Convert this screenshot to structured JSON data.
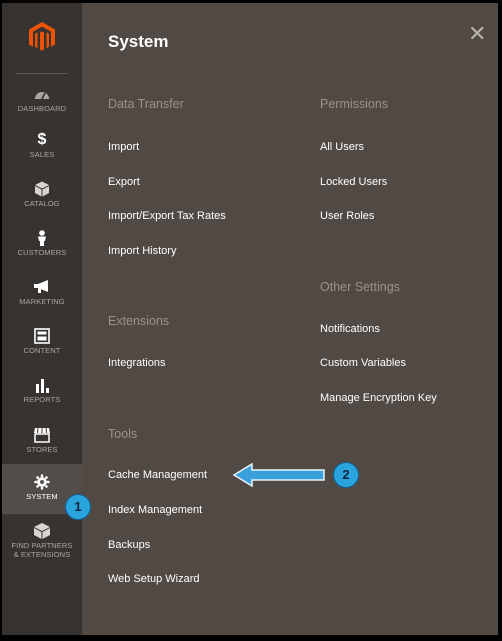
{
  "sidebar": {
    "items": [
      {
        "label": "DASHBOARD",
        "icon": "dashboard-gauge-icon"
      },
      {
        "label": "SALES",
        "icon": "dollar-icon"
      },
      {
        "label": "CATALOG",
        "icon": "cube-icon"
      },
      {
        "label": "CUSTOMERS",
        "icon": "person-icon"
      },
      {
        "label": "MARKETING",
        "icon": "megaphone-icon"
      },
      {
        "label": "CONTENT",
        "icon": "layout-icon"
      },
      {
        "label": "REPORTS",
        "icon": "bar-chart-icon"
      },
      {
        "label": "STORES",
        "icon": "store-icon"
      },
      {
        "label": "SYSTEM",
        "icon": "gear-icon"
      },
      {
        "label1": "FIND PARTNERS",
        "label2": "& EXTENSIONS",
        "icon": "extension-box-icon"
      }
    ]
  },
  "panel": {
    "title": "System",
    "close_icon": "close-icon",
    "sections": {
      "data_transfer": {
        "heading": "Data Transfer",
        "links": [
          "Import",
          "Export",
          "Import/Export Tax Rates",
          "Import History"
        ]
      },
      "extensions": {
        "heading": "Extensions",
        "links": [
          "Integrations"
        ]
      },
      "tools": {
        "heading": "Tools",
        "links": [
          "Cache Management",
          "Index Management",
          "Backups",
          "Web Setup Wizard"
        ]
      },
      "permissions": {
        "heading": "Permissions",
        "links": [
          "All Users",
          "Locked Users",
          "User Roles"
        ]
      },
      "other_settings": {
        "heading": "Other Settings",
        "links": [
          "Notifications",
          "Custom Variables",
          "Manage Encryption Key"
        ]
      }
    }
  },
  "annotations": {
    "badge1": "1",
    "badge2": "2",
    "arrow_color": "#3aa0dc"
  },
  "colors": {
    "sidebar_bg": "#373330",
    "panel_bg": "#514943",
    "logo_orange": "#eb5202",
    "badge_blue": "#2aa4dc"
  }
}
